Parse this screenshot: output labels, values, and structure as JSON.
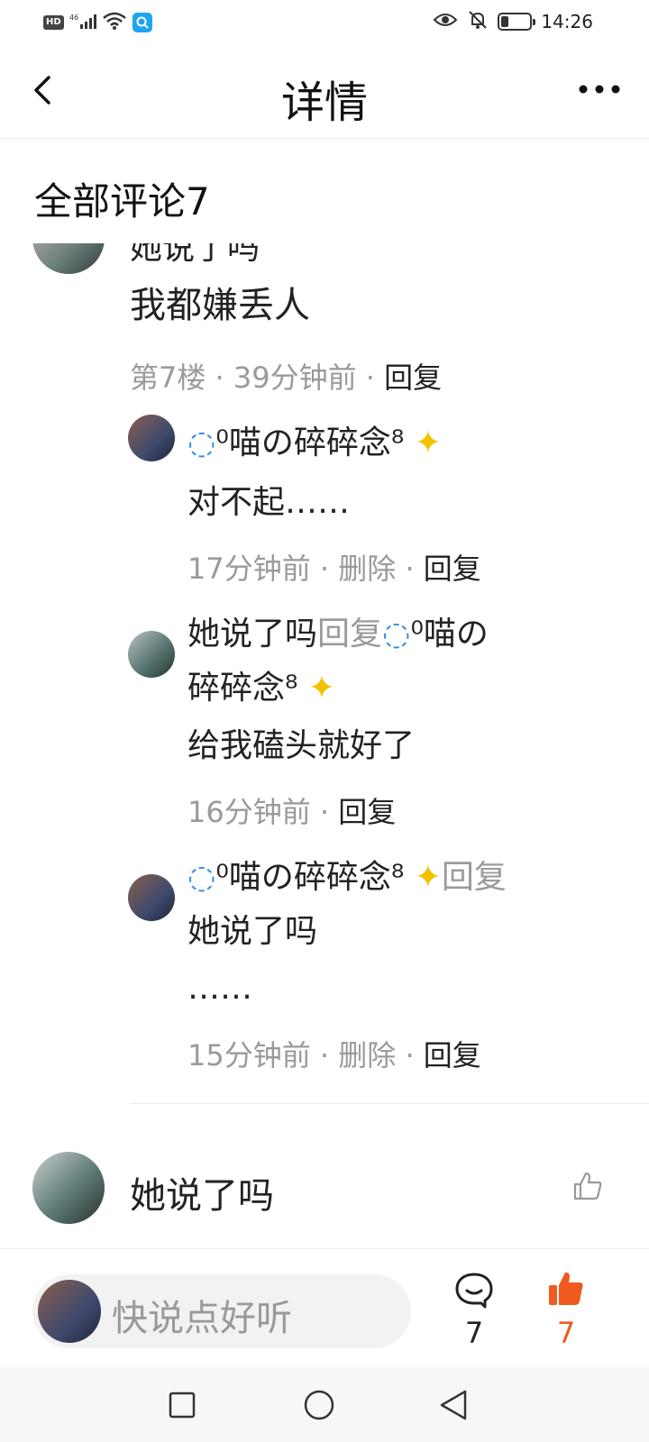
{
  "status_bar": {
    "hd": "HD",
    "network": "46",
    "time": "14:26"
  },
  "header": {
    "title": "详情"
  },
  "comments": {
    "section_title": "全部评论7",
    "main_comment": {
      "partial_name": "她说了吗",
      "text": "我都嫌丢人",
      "floor": "第7楼",
      "time": "39分钟前",
      "reply": "回复"
    },
    "replies": [
      {
        "name": "⁰喵の碎碎念⁸",
        "text": "对不起……",
        "time": "17分钟前",
        "delete": "删除",
        "reply": "回复"
      },
      {
        "name": "她说了吗",
        "reply_word": "回复",
        "target_line1": "⁰喵の",
        "target_line2": "碎碎念⁸",
        "text": "给我磕头就好了",
        "time": "16分钟前",
        "reply": "回复"
      },
      {
        "name": "⁰喵の碎碎念⁸",
        "reply_word": "回复",
        "target": "她说了吗",
        "text": "……",
        "time": "15分钟前",
        "delete": "删除",
        "reply": "回复"
      }
    ],
    "next_comment": {
      "name": "她说了吗"
    }
  },
  "bottom_bar": {
    "placeholder": "快说点好听",
    "comment_count": "7",
    "like_count": "7"
  },
  "colors": {
    "accent_like": "#f05a1e",
    "muted_text": "#9a9a9a"
  }
}
